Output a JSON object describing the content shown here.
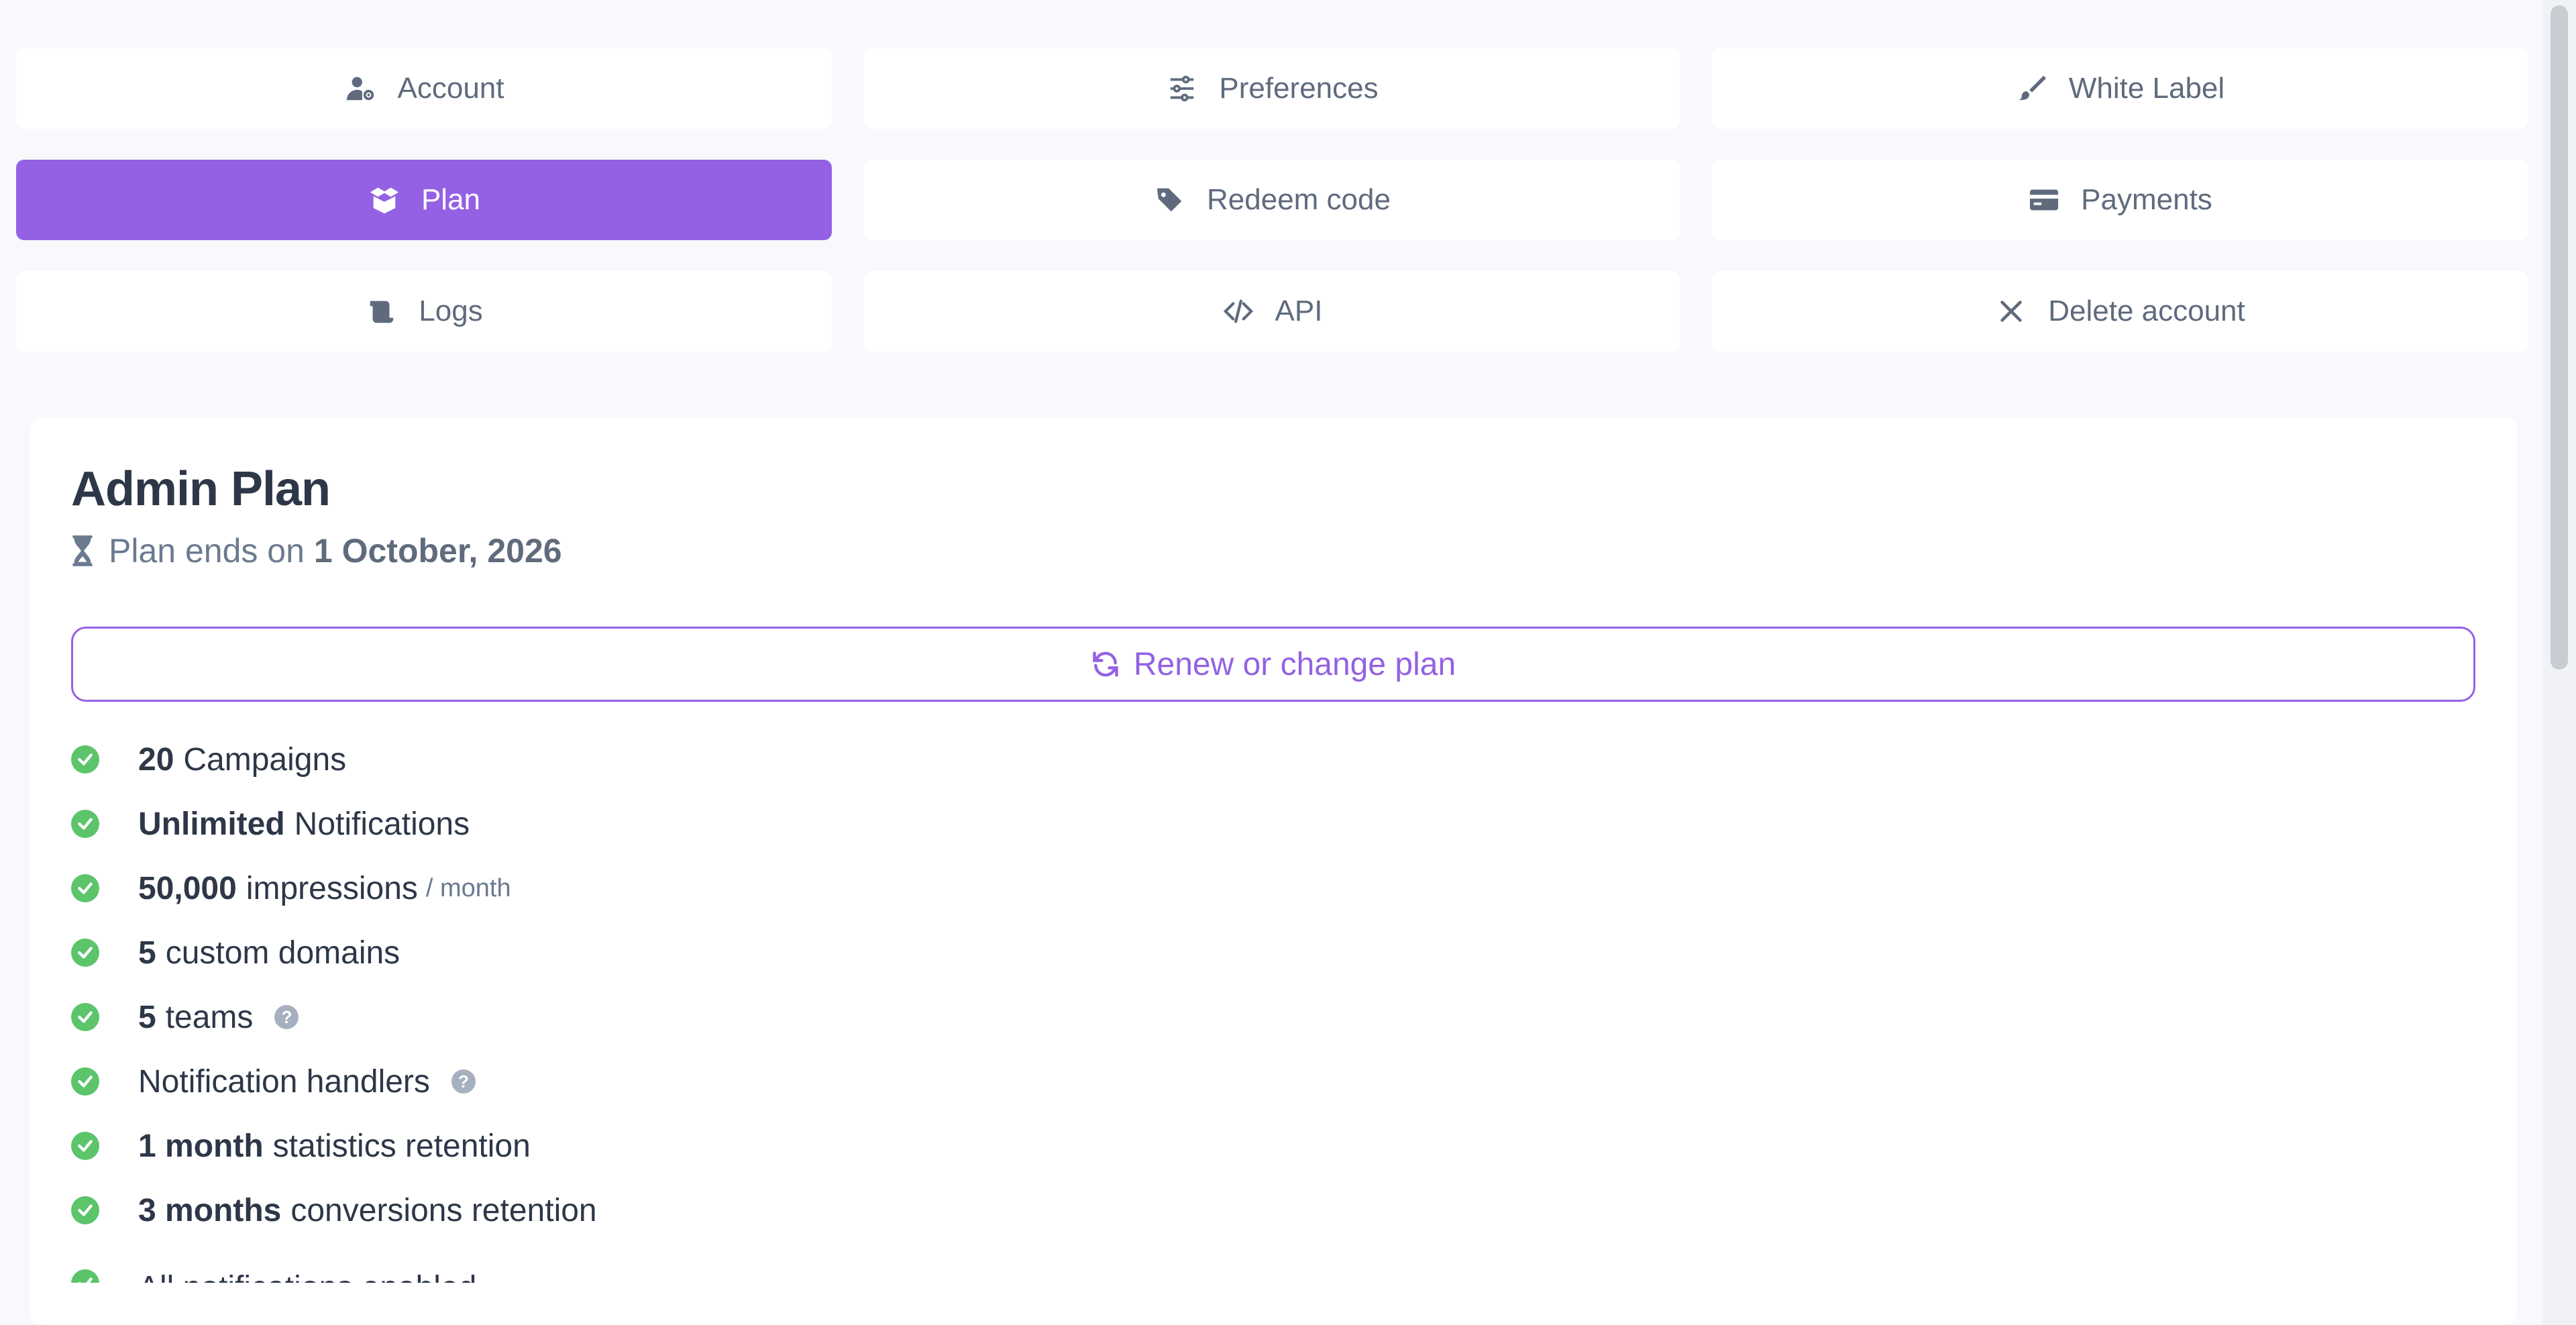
{
  "tabs": [
    {
      "label": "Account",
      "icon": "user-gear-icon",
      "active": false
    },
    {
      "label": "Preferences",
      "icon": "sliders-icon",
      "active": false
    },
    {
      "label": "White Label",
      "icon": "paintbrush-icon",
      "active": false
    },
    {
      "label": "Plan",
      "icon": "box-open-icon",
      "active": true
    },
    {
      "label": "Redeem code",
      "icon": "tags-icon",
      "active": false
    },
    {
      "label": "Payments",
      "icon": "credit-card-icon",
      "active": false
    },
    {
      "label": "Logs",
      "icon": "scroll-icon",
      "active": false
    },
    {
      "label": "API",
      "icon": "code-icon",
      "active": false
    },
    {
      "label": "Delete account",
      "icon": "close-icon",
      "active": false
    }
  ],
  "plan": {
    "title": "Admin Plan",
    "ends_prefix": "Plan ends on",
    "ends_date": "1 October, 2026",
    "renew_label": "Renew or change plan"
  },
  "features": [
    {
      "bold": "20",
      "text": "Campaigns"
    },
    {
      "bold": "Unlimited",
      "text": "Notifications"
    },
    {
      "bold": "50,000",
      "text": "impressions",
      "muted": "/ month"
    },
    {
      "bold": "5",
      "text": "custom domains"
    },
    {
      "bold": "5",
      "text": "teams",
      "help": "?"
    },
    {
      "bold": "",
      "text": "Notification handlers",
      "help": "?"
    },
    {
      "bold": "1 month",
      "text": "statistics retention"
    },
    {
      "bold": "3 months",
      "text": "conversions retention"
    },
    {
      "bold": "",
      "text": "All notifications enabled"
    }
  ],
  "colors": {
    "accent": "#9461e4",
    "check": "#5cc46a",
    "muted": "#6b7a90"
  }
}
